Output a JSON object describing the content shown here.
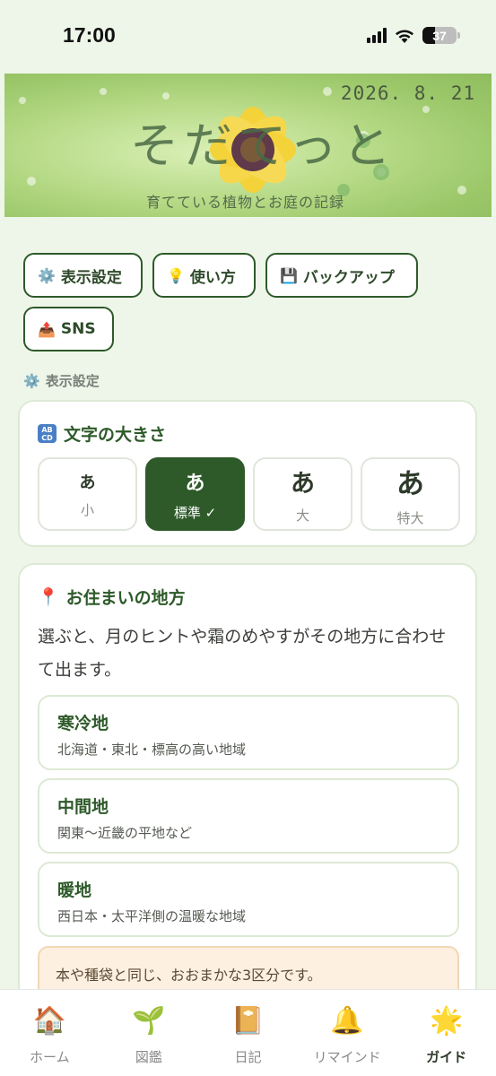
{
  "status_bar": {
    "time": "17:00",
    "battery": "37"
  },
  "header": {
    "date": "2026. 8. 21",
    "title": "そだてっと",
    "subtitle": "育てている植物とお庭の記録"
  },
  "top_buttons": [
    {
      "icon": "⚙️",
      "label": "表示設定"
    },
    {
      "icon": "💡",
      "label": "使い方"
    },
    {
      "icon": "💾",
      "label": "バックアップ"
    },
    {
      "icon": "📤",
      "label": "SNS"
    }
  ],
  "section_label": {
    "icon": "⚙️",
    "text": "表示設定"
  },
  "font_size_card": {
    "title": "文字の大きさ",
    "icon_text": "ABCD",
    "options": [
      {
        "char": "あ",
        "label": "小",
        "selected": false
      },
      {
        "char": "あ",
        "label": "標準 ✓",
        "selected": true
      },
      {
        "char": "あ",
        "label": "大",
        "selected": false
      },
      {
        "char": "あ",
        "label": "特大",
        "selected": false
      }
    ]
  },
  "region_card": {
    "icon": "📍",
    "title": "お住まいの地方",
    "description": "選ぶと、月のヒントや霜のめやすがその地方に合わせて出ます。",
    "regions": [
      {
        "title": "寒冷地",
        "subtitle": "北海道・東北・標高の高い地域"
      },
      {
        "title": "中間地",
        "subtitle": "関東〜近畿の平地など"
      },
      {
        "title": "暖地",
        "subtitle": "西日本・太平洋側の温暖な地域"
      }
    ],
    "note": "本や種袋と同じ、おおまかな3区分です。"
  },
  "bottom_nav": [
    {
      "icon": "🏠",
      "icon_name": "home-icon",
      "label": "ホーム",
      "active": false
    },
    {
      "icon": "🌱",
      "icon_name": "sprout-icon",
      "label": "図鑑",
      "active": false
    },
    {
      "icon": "📔",
      "icon_name": "notebook-icon",
      "label": "日記",
      "active": false
    },
    {
      "icon": "🔔",
      "icon_name": "bell-icon",
      "label": "リマインド",
      "active": false
    },
    {
      "icon": "🌟",
      "icon_name": "star-icon",
      "label": "ガイド",
      "active": true
    }
  ]
}
